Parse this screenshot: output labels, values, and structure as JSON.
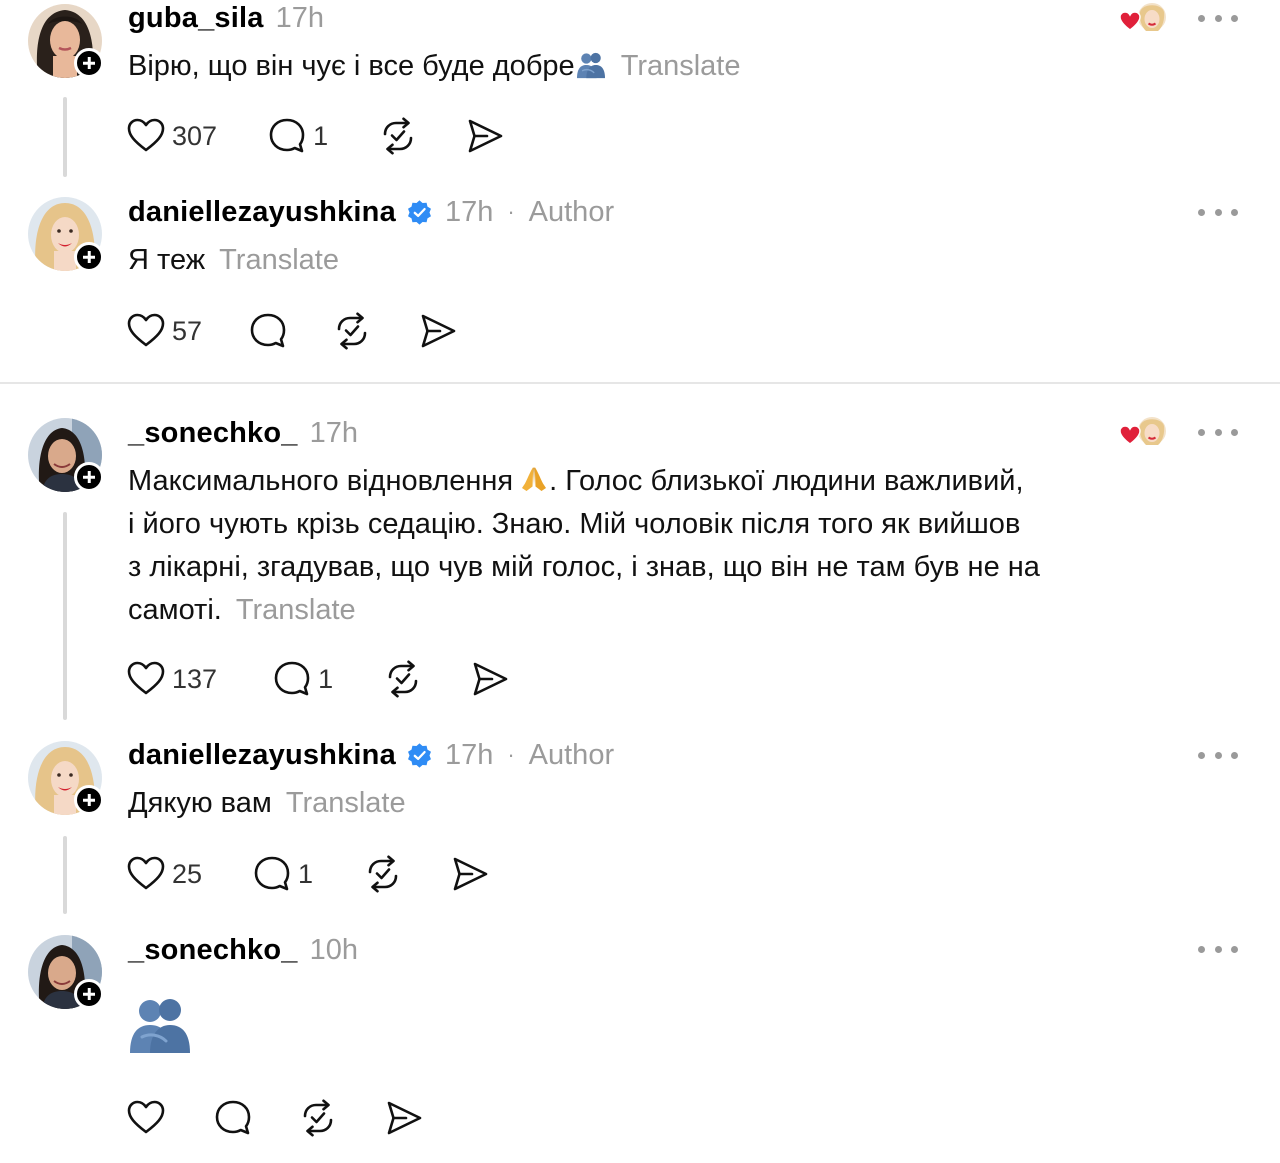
{
  "posts": [
    {
      "username": "guba_sila",
      "time": "17h",
      "text": "Вірю, що він чує і все буде добре",
      "translate": "Translate",
      "likes": "307",
      "replies": "1"
    },
    {
      "username": "daniellezayushkina",
      "time": "17h",
      "separator": "·",
      "author_label": "Author",
      "text": "Я теж",
      "translate": "Translate",
      "likes": "57",
      "replies": ""
    },
    {
      "username": "_sonechko_",
      "time": "17h",
      "text_lines": [
        "Максимального відновлення",
        ". Голос близької людини важливий,",
        "і його чують крізь седацію. Знаю. Мій чоловік після того як вийшов",
        "з лікарні, згадував, що чув мій голос, і знав, що він не там був не на",
        "самоті."
      ],
      "translate": "Translate",
      "likes": "137",
      "replies": "1"
    },
    {
      "username": "daniellezayushkina",
      "time": "17h",
      "separator": "·",
      "author_label": "Author",
      "text": "Дякую вам",
      "translate": "Translate",
      "likes": "25",
      "replies": "1"
    },
    {
      "username": "_sonechko_",
      "time": "10h",
      "likes": "",
      "replies": ""
    }
  ],
  "icons": {
    "like": "heart-icon",
    "reply": "comment-icon",
    "repost": "repost-icon",
    "share": "share-icon",
    "more": "more-icon",
    "verified": "verified-badge-icon",
    "follow": "plus-icon",
    "liked_by_author": "liked-by-author-icon",
    "emoji_hug": "people-hugging-emoji",
    "emoji_pray": "folded-hands-emoji"
  },
  "colors": {
    "text": "#111111",
    "muted": "#9b9b9b",
    "verified": "#2f8cf5",
    "liked_heart": "#e0203a",
    "thread_line": "#d9d9d9"
  }
}
